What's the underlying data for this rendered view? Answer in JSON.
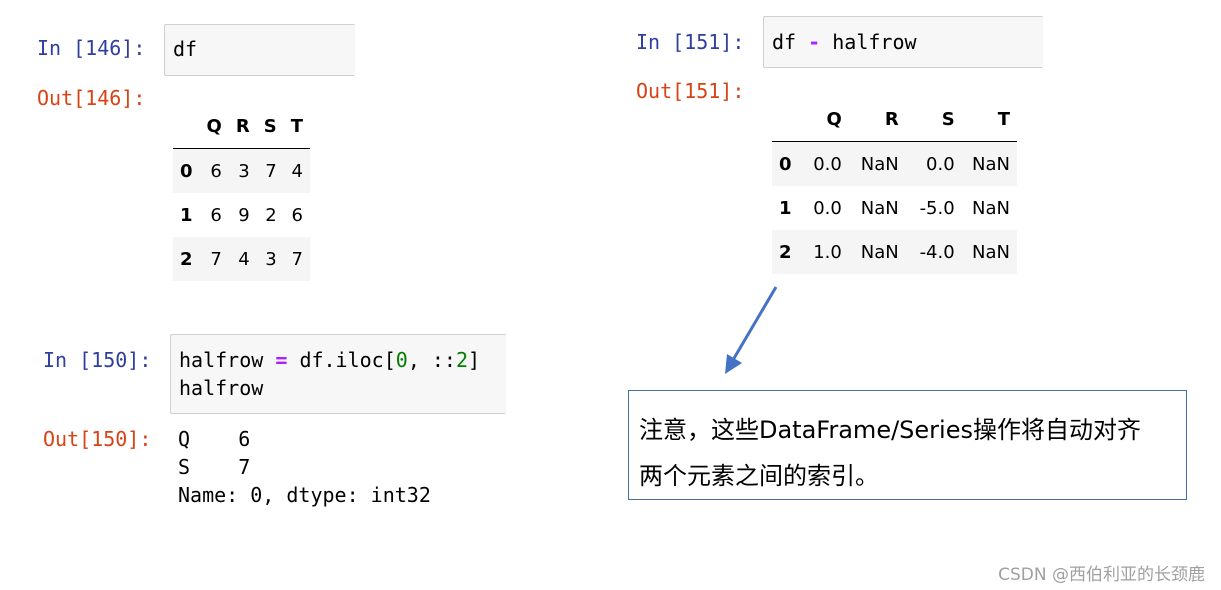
{
  "cell146": {
    "in_prompt": "In [146]:",
    "code": "df",
    "out_prompt": "Out[146]:",
    "table": {
      "columns": [
        "Q",
        "R",
        "S",
        "T"
      ],
      "rows": [
        {
          "index": "0",
          "values": [
            "6",
            "3",
            "7",
            "4"
          ]
        },
        {
          "index": "1",
          "values": [
            "6",
            "9",
            "2",
            "6"
          ]
        },
        {
          "index": "2",
          "values": [
            "7",
            "4",
            "3",
            "7"
          ]
        }
      ]
    }
  },
  "cell150": {
    "in_prompt": "In [150]:",
    "code": {
      "line1": {
        "var": "halfrow",
        "op": "=",
        "call": "df.iloc[",
        "num": "0",
        "mid": ", ::",
        "num2": "2",
        "close": "]"
      },
      "line2": "halfrow"
    },
    "out_prompt": "Out[150]:",
    "output": [
      "Q    6",
      "S    7",
      "Name: 0, dtype: int32"
    ]
  },
  "cell151": {
    "in_prompt": "In [151]:",
    "code": {
      "left": "df",
      "op": "-",
      "right": "halfrow"
    },
    "out_prompt": "Out[151]:",
    "table": {
      "columns": [
        "Q",
        "R",
        "S",
        "T"
      ],
      "rows": [
        {
          "index": "0",
          "values": [
            "0.0",
            "NaN",
            "0.0",
            "NaN"
          ]
        },
        {
          "index": "1",
          "values": [
            "0.0",
            "NaN",
            "-5.0",
            "NaN"
          ]
        },
        {
          "index": "2",
          "values": [
            "1.0",
            "NaN",
            "-4.0",
            "NaN"
          ]
        }
      ]
    }
  },
  "note": {
    "line1": "注意，这些DataFrame/Series操作将自动对齐",
    "line2": "两个元素之间的索引。"
  },
  "watermark": "CSDN @西伯利亚的长颈鹿",
  "colors": {
    "in_prompt": "#303f9f",
    "out_prompt": "#d84315",
    "operator": "#aa22ff",
    "number": "#008000",
    "arrow": "#4472c4",
    "note_border": "#41719c"
  },
  "icons": [
    "arrow-down-left-icon"
  ]
}
